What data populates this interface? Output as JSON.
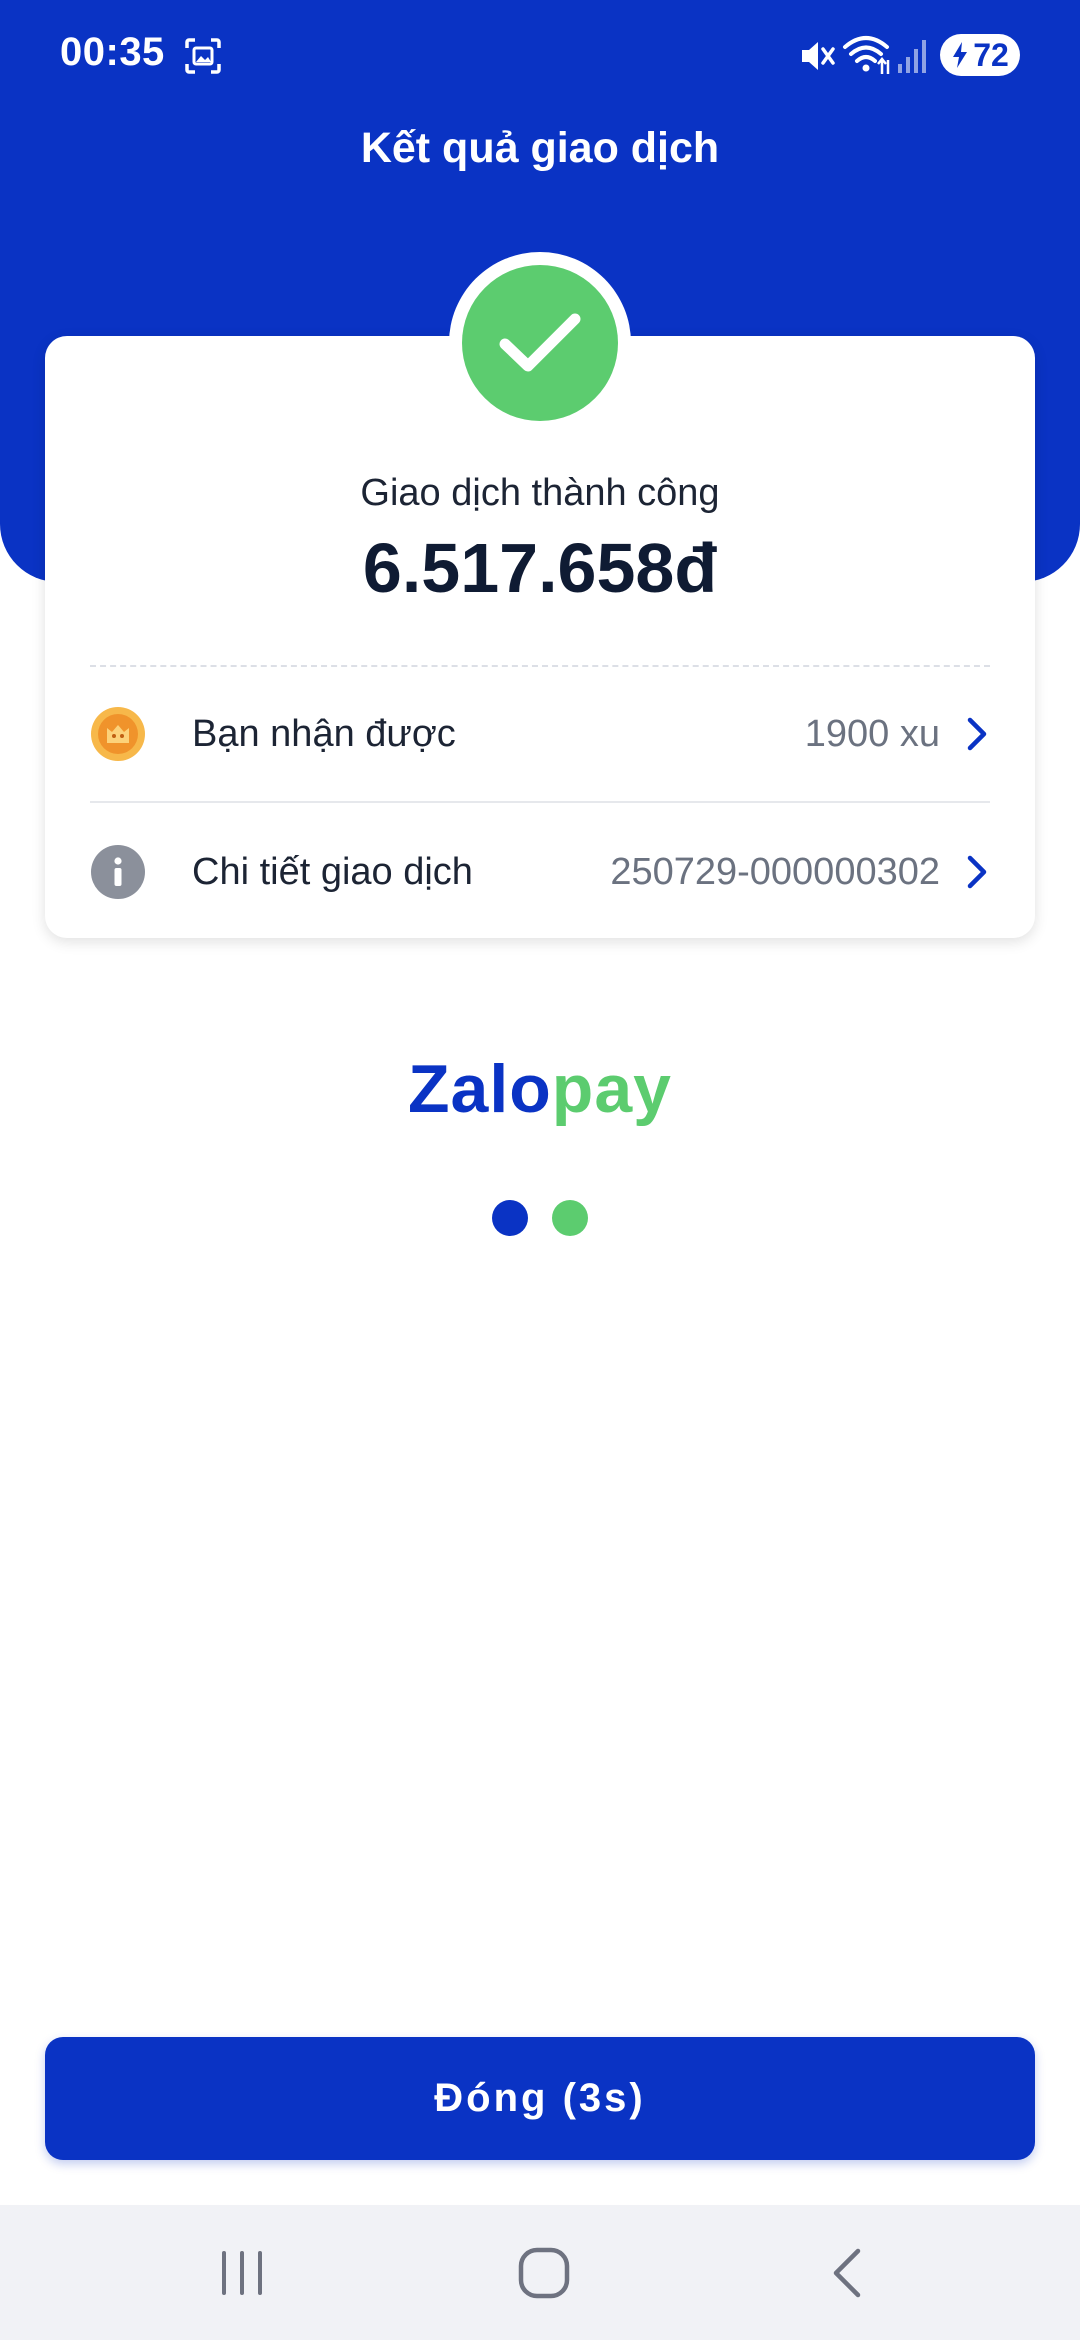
{
  "status_bar": {
    "time": "00:35",
    "battery": "72",
    "icons": [
      "screenshot-icon",
      "mute-icon",
      "wifi-icon",
      "signal-icon",
      "battery-charging-icon"
    ]
  },
  "header": {
    "title": "Kết quả giao dịch"
  },
  "result": {
    "status_label": "Giao dịch thành công",
    "amount": "6.517.658đ",
    "status_icon": "check-icon"
  },
  "rows": [
    {
      "label": "Bạn nhận được",
      "value": "1900 xu",
      "icon": "coin-icon"
    },
    {
      "label": "Chi tiết giao dịch",
      "value": "250729-000000302",
      "icon": "info-icon"
    }
  ],
  "brand": {
    "part1": "Zalo",
    "part2": "pay"
  },
  "actions": {
    "close_label": "Đóng (3s)"
  },
  "colors": {
    "primary": "#0a33c4",
    "success": "#5ccc6f",
    "text_dark": "#0f1b33",
    "text_muted": "#6b7280",
    "nav_bg": "#f1f2f6"
  }
}
